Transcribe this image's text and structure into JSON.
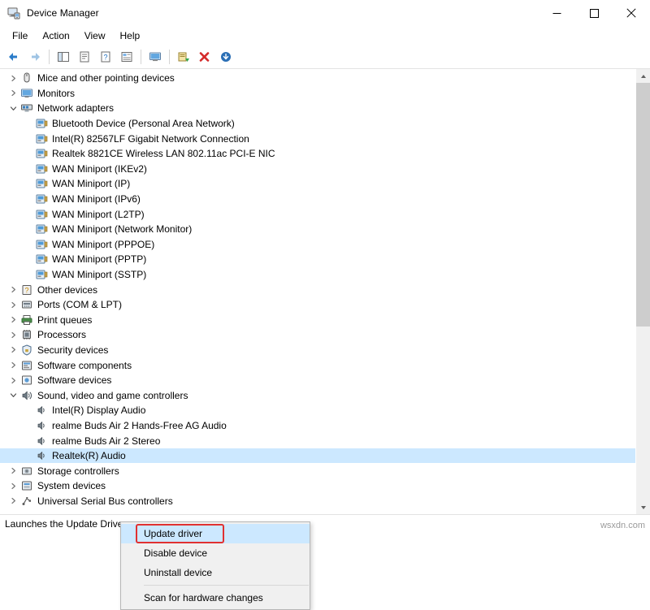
{
  "window": {
    "title": "Device Manager",
    "app_icon": "device-manager-icon",
    "minimize": "minimize-icon",
    "maximize": "maximize-icon",
    "close": "close-icon"
  },
  "menu": {
    "items": [
      {
        "label": "File",
        "name": "menu-file"
      },
      {
        "label": "Action",
        "name": "menu-action"
      },
      {
        "label": "View",
        "name": "menu-view"
      },
      {
        "label": "Help",
        "name": "menu-help"
      }
    ]
  },
  "toolbar": {
    "buttons": [
      {
        "name": "back-button",
        "icon": "back-arrow-icon"
      },
      {
        "name": "forward-button",
        "icon": "forward-arrow-icon"
      },
      {
        "name": "show-hide-console-tree-button",
        "icon": "console-tree-icon"
      },
      {
        "name": "properties-button",
        "icon": "properties-icon"
      },
      {
        "name": "help-button",
        "icon": "question-mark-icon"
      },
      {
        "name": "view-devices-button",
        "icon": "view-devices-icon"
      },
      {
        "name": "scan-hardware-button",
        "icon": "monitor-icon"
      },
      {
        "name": "update-driver-button",
        "icon": "update-driver-icon"
      },
      {
        "name": "uninstall-device-button",
        "icon": "red-x-icon"
      },
      {
        "name": "disable-device-button",
        "icon": "down-arrow-circle-icon"
      }
    ]
  },
  "tree": {
    "nodes": [
      {
        "label": "Mice and other pointing devices",
        "indent": 1,
        "chev": "right",
        "icon": "mouse-icon",
        "name": "tree-node-mice"
      },
      {
        "label": "Monitors",
        "indent": 1,
        "chev": "right",
        "icon": "monitor-icon",
        "name": "tree-node-monitors"
      },
      {
        "label": "Network adapters",
        "indent": 1,
        "chev": "down",
        "icon": "network-icon",
        "name": "tree-node-network-adapters"
      },
      {
        "label": "Bluetooth Device (Personal Area Network)",
        "indent": 2,
        "chev": "none",
        "icon": "network-adapter-icon",
        "name": "tree-node-bluetooth-pan"
      },
      {
        "label": "Intel(R) 82567LF Gigabit Network Connection",
        "indent": 2,
        "chev": "none",
        "icon": "network-adapter-icon",
        "name": "tree-node-intel-82567lf"
      },
      {
        "label": "Realtek 8821CE Wireless LAN 802.11ac PCI-E NIC",
        "indent": 2,
        "chev": "none",
        "icon": "network-adapter-icon",
        "name": "tree-node-realtek-8821ce"
      },
      {
        "label": "WAN Miniport (IKEv2)",
        "indent": 2,
        "chev": "none",
        "icon": "network-adapter-icon",
        "name": "tree-node-wan-ikev2"
      },
      {
        "label": "WAN Miniport (IP)",
        "indent": 2,
        "chev": "none",
        "icon": "network-adapter-icon",
        "name": "tree-node-wan-ip"
      },
      {
        "label": "WAN Miniport (IPv6)",
        "indent": 2,
        "chev": "none",
        "icon": "network-adapter-icon",
        "name": "tree-node-wan-ipv6"
      },
      {
        "label": "WAN Miniport (L2TP)",
        "indent": 2,
        "chev": "none",
        "icon": "network-adapter-icon",
        "name": "tree-node-wan-l2tp"
      },
      {
        "label": "WAN Miniport (Network Monitor)",
        "indent": 2,
        "chev": "none",
        "icon": "network-adapter-icon",
        "name": "tree-node-wan-netmon"
      },
      {
        "label": "WAN Miniport (PPPOE)",
        "indent": 2,
        "chev": "none",
        "icon": "network-adapter-icon",
        "name": "tree-node-wan-pppoe"
      },
      {
        "label": "WAN Miniport (PPTP)",
        "indent": 2,
        "chev": "none",
        "icon": "network-adapter-icon",
        "name": "tree-node-wan-pptp"
      },
      {
        "label": "WAN Miniport (SSTP)",
        "indent": 2,
        "chev": "none",
        "icon": "network-adapter-icon",
        "name": "tree-node-wan-sstp"
      },
      {
        "label": "Other devices",
        "indent": 1,
        "chev": "right",
        "icon": "other-device-icon",
        "name": "tree-node-other-devices"
      },
      {
        "label": "Ports (COM & LPT)",
        "indent": 1,
        "chev": "right",
        "icon": "port-icon",
        "name": "tree-node-ports"
      },
      {
        "label": "Print queues",
        "indent": 1,
        "chev": "right",
        "icon": "printer-icon",
        "name": "tree-node-print-queues"
      },
      {
        "label": "Processors",
        "indent": 1,
        "chev": "right",
        "icon": "processor-icon",
        "name": "tree-node-processors"
      },
      {
        "label": "Security devices",
        "indent": 1,
        "chev": "right",
        "icon": "security-icon",
        "name": "tree-node-security-devices"
      },
      {
        "label": "Software components",
        "indent": 1,
        "chev": "right",
        "icon": "software-component-icon",
        "name": "tree-node-software-components"
      },
      {
        "label": "Software devices",
        "indent": 1,
        "chev": "right",
        "icon": "software-device-icon",
        "name": "tree-node-software-devices"
      },
      {
        "label": "Sound, video and game controllers",
        "indent": 1,
        "chev": "down",
        "icon": "sound-icon",
        "name": "tree-node-sound-video-game"
      },
      {
        "label": "Intel(R) Display Audio",
        "indent": 2,
        "chev": "none",
        "icon": "speaker-icon",
        "name": "tree-node-intel-display-audio"
      },
      {
        "label": "realme Buds Air 2 Hands-Free AG Audio",
        "indent": 2,
        "chev": "none",
        "icon": "speaker-icon",
        "name": "tree-node-realme-handsfree"
      },
      {
        "label": "realme Buds Air 2 Stereo",
        "indent": 2,
        "chev": "none",
        "icon": "speaker-icon",
        "name": "tree-node-realme-stereo"
      },
      {
        "label": "Realtek(R) Audio",
        "indent": 2,
        "chev": "none",
        "icon": "speaker-icon",
        "name": "tree-node-realtek-audio",
        "selected": true
      },
      {
        "label": "Storage controllers",
        "indent": 1,
        "chev": "right",
        "icon": "storage-icon",
        "name": "tree-node-storage-controllers"
      },
      {
        "label": "System devices",
        "indent": 1,
        "chev": "right",
        "icon": "system-device-icon",
        "name": "tree-node-system-devices"
      },
      {
        "label": "Universal Serial Bus controllers",
        "indent": 1,
        "chev": "right",
        "icon": "usb-icon",
        "name": "tree-node-usb-controllers"
      }
    ]
  },
  "context_menu": {
    "items": [
      {
        "label": "Update driver",
        "name": "context-menu-update-driver",
        "highlight": true
      },
      {
        "label": "Disable device",
        "name": "context-menu-disable-device",
        "highlight": false
      },
      {
        "label": "Uninstall device",
        "name": "context-menu-uninstall-device",
        "highlight": false
      },
      {
        "label": "Scan for hardware changes",
        "name": "context-menu-scan-hardware",
        "highlight": false,
        "after_sep": true
      }
    ]
  },
  "status_bar": {
    "text": "Launches the Update Drive"
  },
  "watermark": {
    "text": "wsxdn.com"
  },
  "colors": {
    "selection": "#cce8ff",
    "highlight_box": "#e03131",
    "scrollbar_thumb": "#cdcdcd",
    "scrollbar_track": "#f0f0f0"
  }
}
